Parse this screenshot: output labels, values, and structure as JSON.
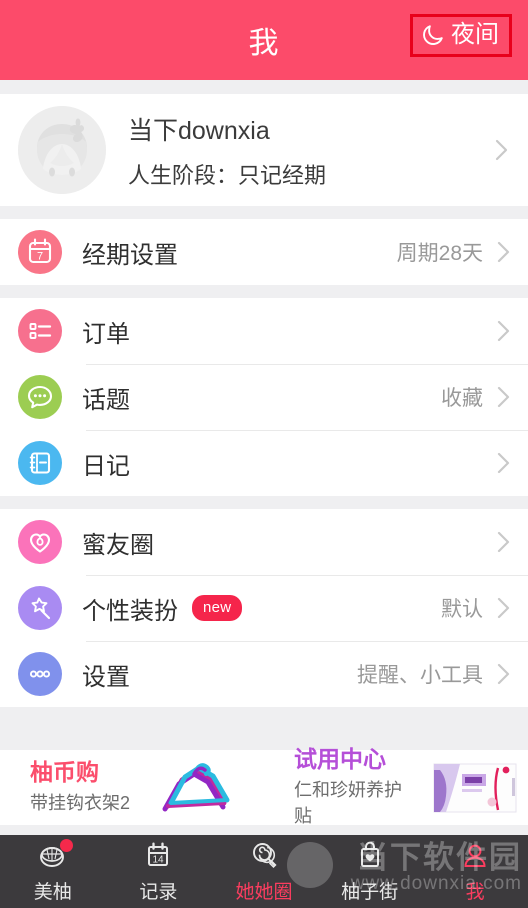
{
  "header": {
    "title": "我",
    "night_mode_label": "夜间",
    "night_mode_icon": "moon-icon",
    "bg_color": "#fc4b6a",
    "highlight_color": "#e8001b"
  },
  "profile": {
    "name": "当下downxia",
    "subtitle": "人生阶段：只记经期",
    "avatar_icon": "avatar-placeholder-icon",
    "chevron_icon": "chevron-right-icon"
  },
  "groups": [
    {
      "rows": [
        {
          "label": "经期设置",
          "value": "周期28天",
          "icon": "calendar-icon",
          "icon_text": "7",
          "icon_color": "#f97588",
          "badge": null
        }
      ]
    },
    {
      "rows": [
        {
          "label": "订单",
          "value": "",
          "icon": "order-list-icon",
          "icon_color": "#f7708e",
          "badge": null
        },
        {
          "label": "话题",
          "value": "收藏",
          "icon": "chat-bubble-icon",
          "icon_color": "#9ccd52",
          "badge": null
        },
        {
          "label": "日记",
          "value": "",
          "icon": "notebook-icon",
          "icon_color": "#4bb8f0",
          "badge": null
        }
      ]
    },
    {
      "rows": [
        {
          "label": "蜜友圈",
          "value": "",
          "icon": "heart-icon",
          "icon_color": "#fb73ba",
          "badge": null
        },
        {
          "label": "个性装扮",
          "value": "默认",
          "icon": "magic-wand-icon",
          "icon_color": "#a98bf2",
          "badge": "new"
        },
        {
          "label": "设置",
          "value": "提醒、小工具",
          "icon": "more-dots-icon",
          "icon_color": "#8091ec",
          "badge": null
        }
      ]
    }
  ],
  "promos": [
    {
      "title": "柚币购",
      "subtitle": "带挂钩衣架2",
      "title_color": "#fb4e6c",
      "image_icon": "clothes-hangers-image"
    },
    {
      "title": "试用中心",
      "subtitle": "仁和珍妍养护贴",
      "title_color": "#b54fd8",
      "image_icon": "product-box-image"
    }
  ],
  "tabbar": {
    "active_color": "#fb3d5f",
    "bg_color": "#3c3a3d",
    "tabs": [
      {
        "label": "美柚",
        "icon": "pomelo-icon",
        "active": false,
        "badge_dot": true
      },
      {
        "label": "记录",
        "icon": "calendar-14-icon",
        "icon_text": "14",
        "active": false,
        "badge_dot": false
      },
      {
        "label": "她她圈",
        "icon": "lollipop-icon",
        "active": true,
        "badge_dot": false
      },
      {
        "label": "柚子街",
        "icon": "shopping-bag-icon",
        "active": false,
        "badge_dot": false
      },
      {
        "label": "我",
        "icon": "person-icon",
        "active": true,
        "badge_dot": false
      }
    ]
  },
  "watermark": {
    "line1": "当下软件园",
    "line2": "www.downxia.com"
  }
}
